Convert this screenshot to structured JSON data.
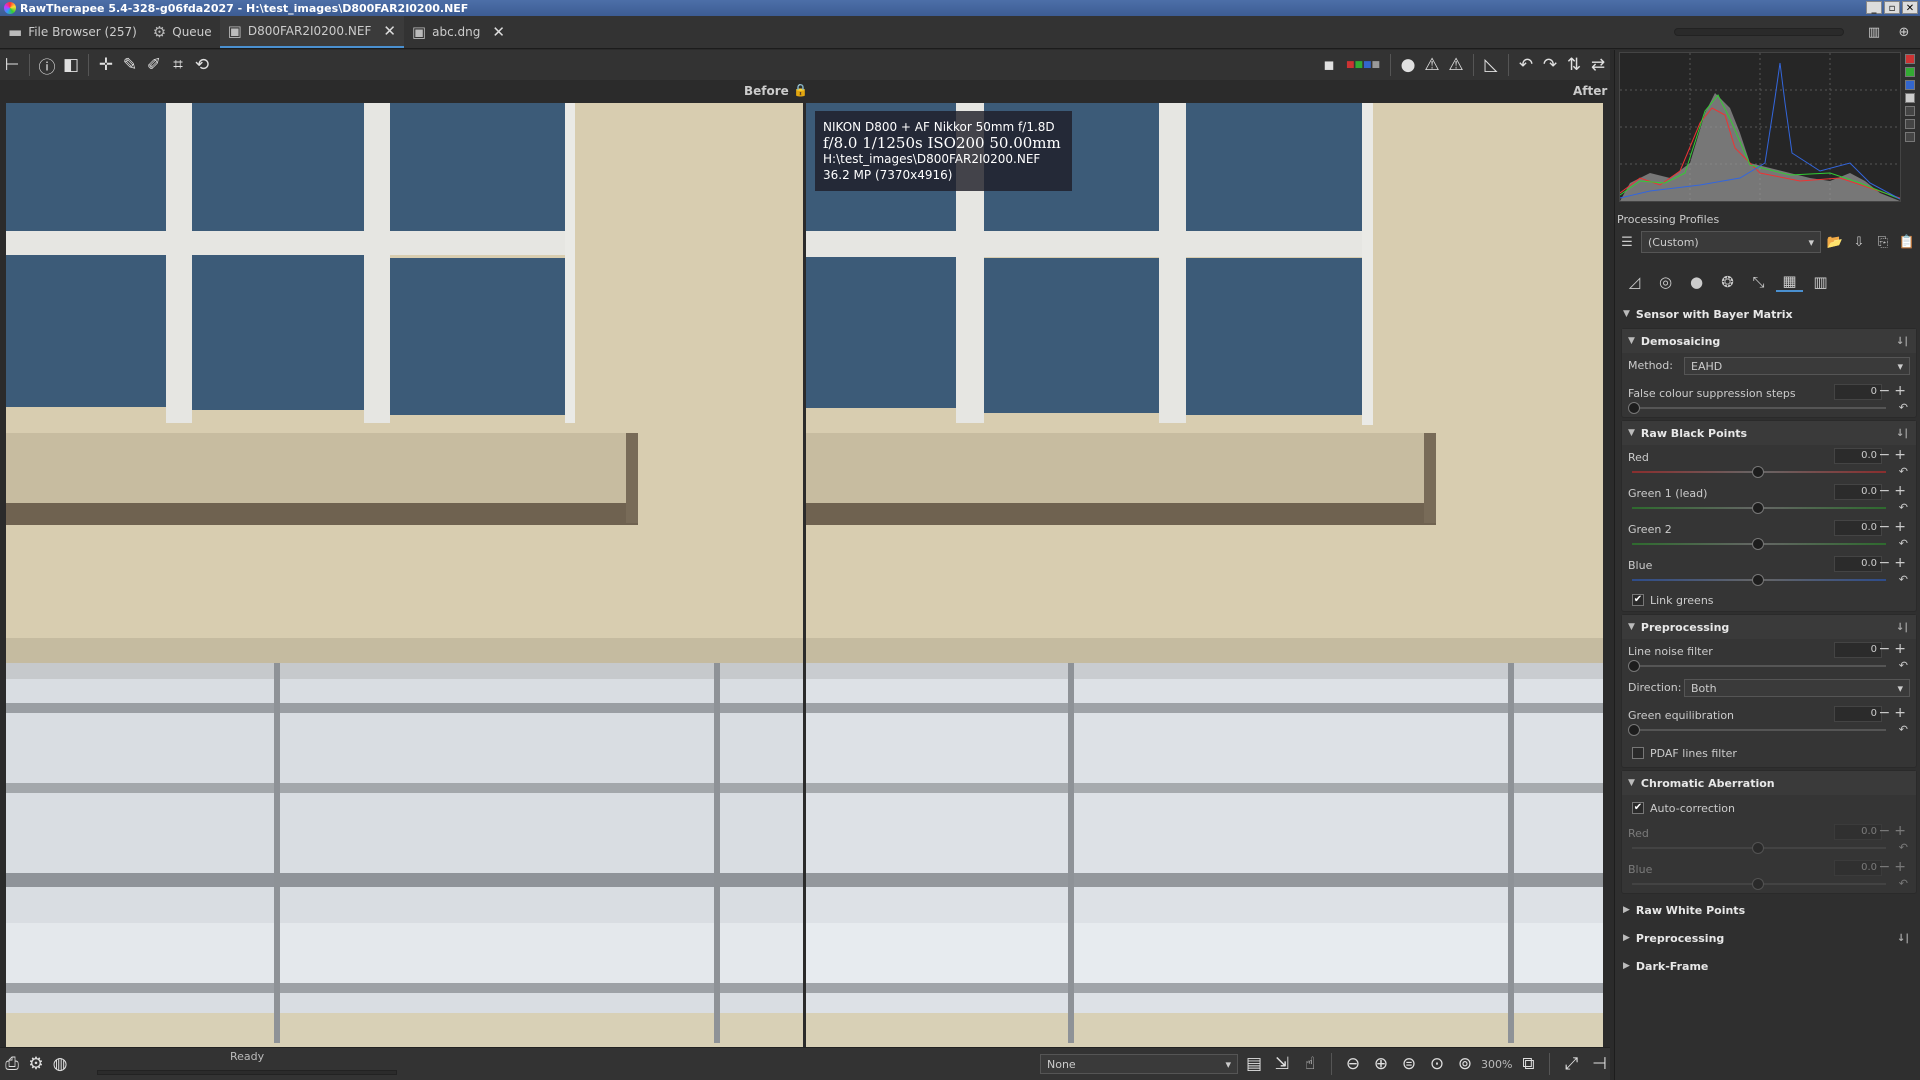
{
  "window": {
    "title": "RawTherapee 5.4-328-g06fda2027 - H:\\test_images\\D800FAR2I0200.NEF"
  },
  "tabs": [
    {
      "label": "File Browser (257)",
      "icon": "folder-icon"
    },
    {
      "label": "Queue",
      "icon": "gears-icon"
    },
    {
      "label": "D800FAR2I0200.NEF",
      "icon": "image-icon",
      "closable": true,
      "active": true
    },
    {
      "label": "abc.dng",
      "icon": "image-icon",
      "closable": true
    }
  ],
  "preview": {
    "before_label": "Before",
    "after_label": "After"
  },
  "exif": {
    "camera": "NIKON D800 + AF Nikkor 50mm f/1.8D",
    "exposure": "f/8.0  1/1250s  ISO200  50.00mm",
    "path": "H:\\test_images\\D800FAR2I0200.NEF",
    "size": "36.2 MP (7370x4916)"
  },
  "panel": {
    "processing_profiles_label": "Processing Profiles",
    "profile_value": "(Custom)",
    "sensor_section": "Sensor with Bayer Matrix",
    "demosaicing": {
      "title": "Demosaicing",
      "method_label": "Method:",
      "method_value": "EAHD",
      "false_colour_label": "False colour suppression steps",
      "false_colour_value": "0"
    },
    "raw_black_points": {
      "title": "Raw Black Points",
      "fields": [
        {
          "label": "Red",
          "value": "0.0"
        },
        {
          "label": "Green 1 (lead)",
          "value": "0.0"
        },
        {
          "label": "Green 2",
          "value": "0.0"
        },
        {
          "label": "Blue",
          "value": "0.0"
        }
      ],
      "link_greens": "Link greens"
    },
    "preprocessing": {
      "title": "Preprocessing",
      "line_noise_label": "Line noise filter",
      "line_noise_value": "0",
      "direction_label": "Direction:",
      "direction_value": "Both",
      "green_eq_label": "Green equilibration",
      "green_eq_value": "0",
      "pdaf_label": "PDAF lines filter"
    },
    "chromatic_aberration": {
      "title": "Chromatic Aberration",
      "auto_label": "Auto-correction",
      "red_label": "Red",
      "red_value": "0.0",
      "blue_label": "Blue",
      "blue_value": "0.0"
    },
    "collapsed": [
      "Raw White Points",
      "Preprocessing",
      "Dark-Frame"
    ]
  },
  "statusbar": {
    "status": "Ready",
    "mode_value": "None",
    "zoom": "300%"
  },
  "colors": {
    "accent": "#4a90d0",
    "panel_bg": "#2f2f2f",
    "title_bg": "#3d5c93"
  }
}
